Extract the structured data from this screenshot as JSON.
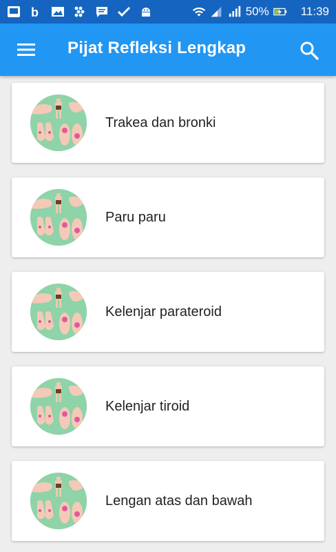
{
  "status_bar": {
    "battery": "50%",
    "time": "11:39"
  },
  "app_bar": {
    "title": "Pijat Refleksi Lengkap"
  },
  "items": [
    {
      "label": "Trakea dan bronki"
    },
    {
      "label": "Paru paru"
    },
    {
      "label": "Kelenjar parateroid"
    },
    {
      "label": "Kelenjar tiroid"
    },
    {
      "label": "Lengan atas dan bawah"
    }
  ],
  "colors": {
    "status_bar": "#1565c0",
    "app_bar": "#2196f3",
    "background": "#eeeeee",
    "thumb_bg": "#8fd3a8"
  }
}
